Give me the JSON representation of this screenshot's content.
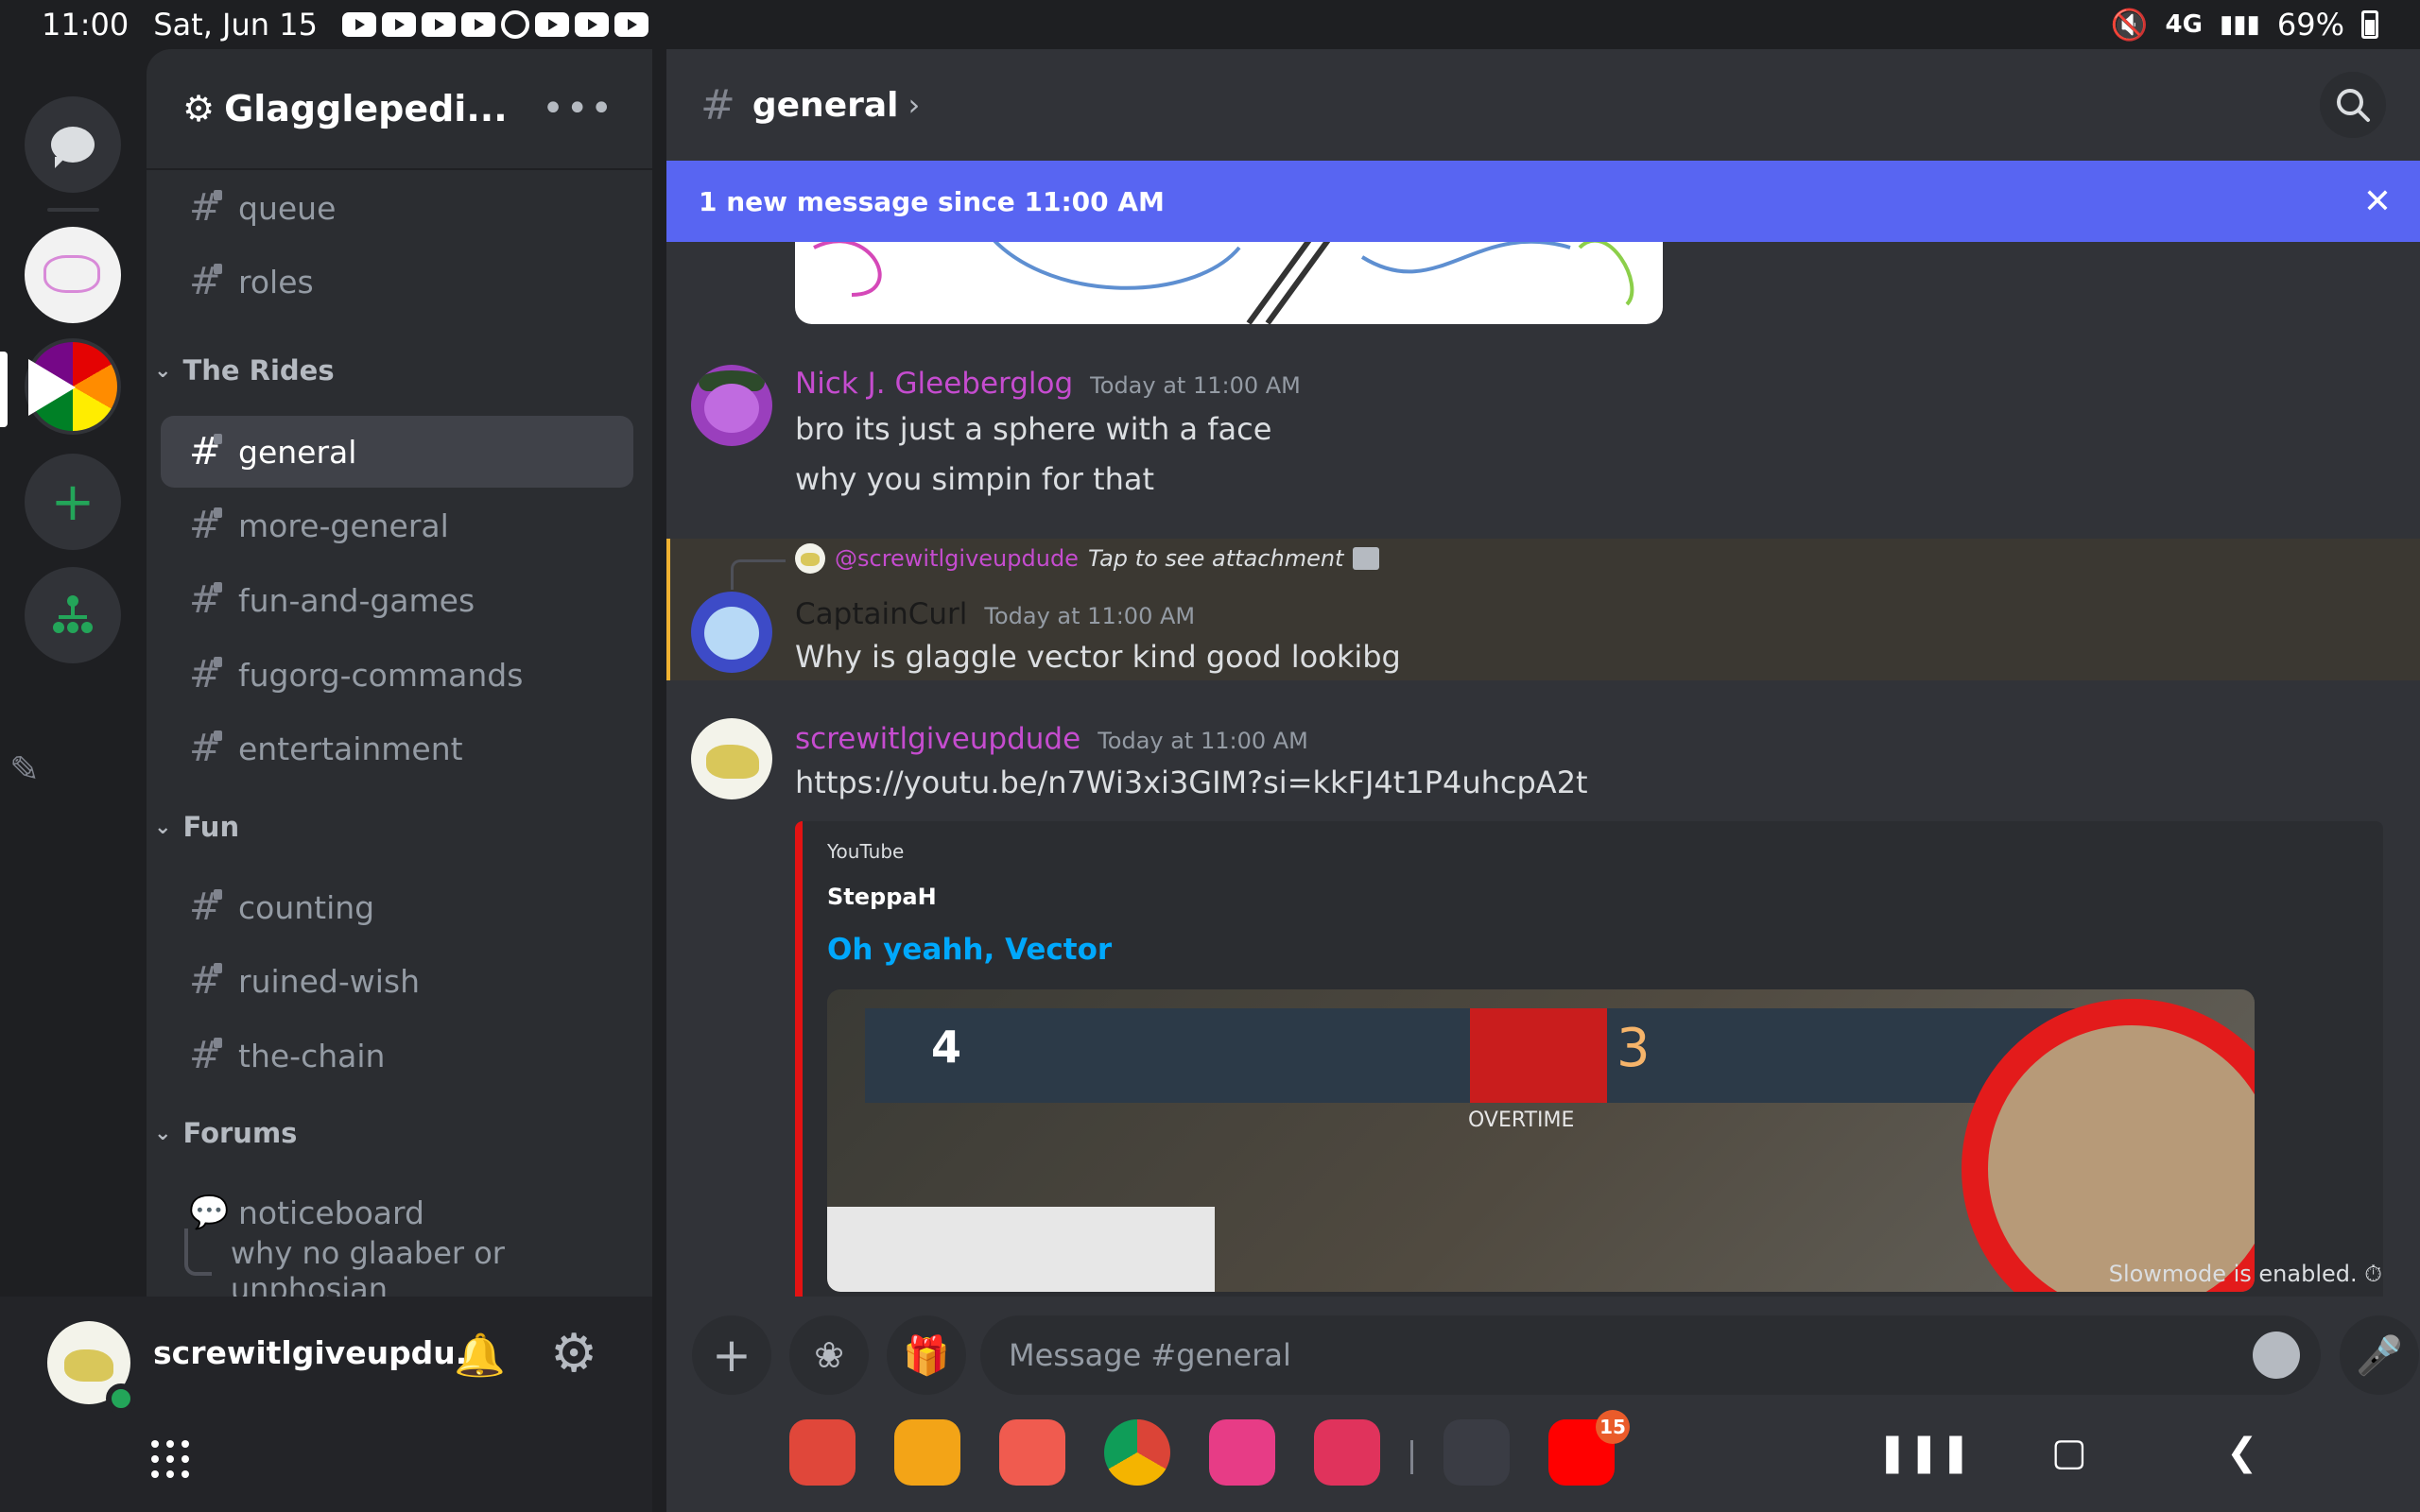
{
  "status": {
    "time": "11:00",
    "date": "Sat, Jun 15",
    "network": "4G",
    "battery": "69%"
  },
  "server": {
    "name": "Glagglepedi...",
    "menu": "•••"
  },
  "channels_top": [
    {
      "name": "queue"
    },
    {
      "name": "roles"
    }
  ],
  "categories": {
    "rides": "The Rides",
    "fun": "Fun",
    "forums": "Forums"
  },
  "channels_rides": [
    {
      "name": "general",
      "active": true
    },
    {
      "name": "more-general"
    },
    {
      "name": "fun-and-games"
    },
    {
      "name": "fugorg-commands"
    },
    {
      "name": "entertainment"
    }
  ],
  "channels_fun": [
    {
      "name": "counting"
    },
    {
      "name": "ruined-wish"
    },
    {
      "name": "the-chain"
    }
  ],
  "forums": [
    {
      "name": "noticeboard"
    }
  ],
  "thread": "why no glaaber or unphosian",
  "user": {
    "name": "screwitlgiveupdu..."
  },
  "channel_header": {
    "title": "general"
  },
  "new_messages_bar": {
    "text": "1 new message since 11:00 AM"
  },
  "messages": [
    {
      "author": "Nick J. Gleeberglog",
      "author_color": "#c54ccf",
      "time": "Today at 11:00 AM",
      "lines": [
        "bro its just a sphere with a face",
        "why you simpin for that"
      ]
    },
    {
      "reply_to": "@screwitlgiveupdude",
      "reply_text": "Tap to see attachment",
      "author": "CaptainCurl",
      "author_color": "#1a1a1a",
      "time": "Today at 11:00 AM",
      "lines": [
        "Why is glaggle vector kind good lookibg"
      ]
    },
    {
      "author": "screwitlgiveupdude",
      "author_color": "#c54ccf",
      "time": "Today at 11:00 AM",
      "link": "https://youtu.be/n7Wi3xi3GIM?si=kkFJ4t1P4uhcpA2t",
      "embed": {
        "provider": "YouTube",
        "author": "SteppaH",
        "title": "Oh yeahh, Vector",
        "thumb_score": "4",
        "thumb_overtime": "OVERTIME",
        "thumb_count": "3",
        "thumb_count2": "3"
      }
    }
  ],
  "slowmode": "Slowmode is enabled.",
  "composer": {
    "placeholder": "Message #general"
  },
  "taskbar": {
    "youtube_badge": "15"
  }
}
